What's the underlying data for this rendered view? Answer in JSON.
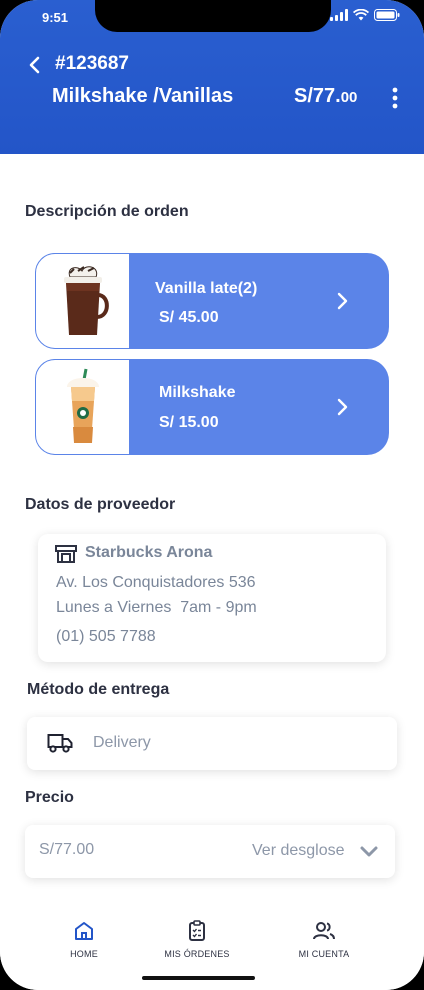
{
  "status_bar": {
    "time": "9:51"
  },
  "header": {
    "order_id": "#123687",
    "title": "Milkshake /Vanillas",
    "total_main": "S/77.",
    "total_cents": "00"
  },
  "order_section": {
    "label": "Descripción de orden",
    "items": [
      {
        "name": "Vanilla late(2)",
        "price": "S/ 45.00",
        "image": "hot-chocolate-icon"
      },
      {
        "name": "Milkshake",
        "price": "S/ 15.00",
        "image": "frappuccino-icon"
      }
    ]
  },
  "provider_section": {
    "label": "Datos de proveedor",
    "name": "Starbucks Arona",
    "address": "Av. Los Conquistadores 536",
    "hours": "Lunes a Viernes  7am - 9pm",
    "phone": "(01) 505 7788"
  },
  "delivery_section": {
    "label": "Método de entrega",
    "method": "Delivery"
  },
  "price_section": {
    "label": "Precio",
    "amount": "S/77.00",
    "breakdown_label": "Ver desglose"
  },
  "tabbar": {
    "home": "HOME",
    "orders": "MIS ÓRDENES",
    "account": "MI CUENTA"
  },
  "colors": {
    "header_blue": "#2355c8",
    "card_blue": "#5b84e8",
    "active_tab": "#2355c8"
  }
}
